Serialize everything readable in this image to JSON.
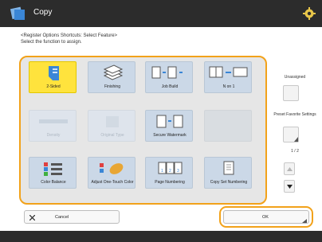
{
  "header": {
    "title": "Copy"
  },
  "instructions": {
    "line1": "<Register Options Shortcuts: Select Feature>",
    "line2": "Select the function to assign."
  },
  "tiles": {
    "two_sided": "2-Sided",
    "finishing": "Finishing",
    "job_build": "Job Build",
    "n_on_1": "N on 1",
    "density": "Density",
    "original_type": "Original Type",
    "secure_watermark": "Secure Watermark",
    "color_balance": "Color Balance",
    "adjust_one_touch": "Adjust One-Touch Color",
    "page_numbering": "Page Numbering",
    "copy_set_numbering": "Copy Set Numbering"
  },
  "right_panel": {
    "unassigned": "Unassigned",
    "preset_favorite": "Preset Favorite Settings",
    "page_indicator": "1 / 2"
  },
  "buttons": {
    "cancel": "Cancel",
    "ok": "OK"
  },
  "colors": {
    "accent": "#f2a21a",
    "selected": "#ffe33d",
    "tile": "#cbd8e7",
    "header": "#2c2c2c"
  }
}
